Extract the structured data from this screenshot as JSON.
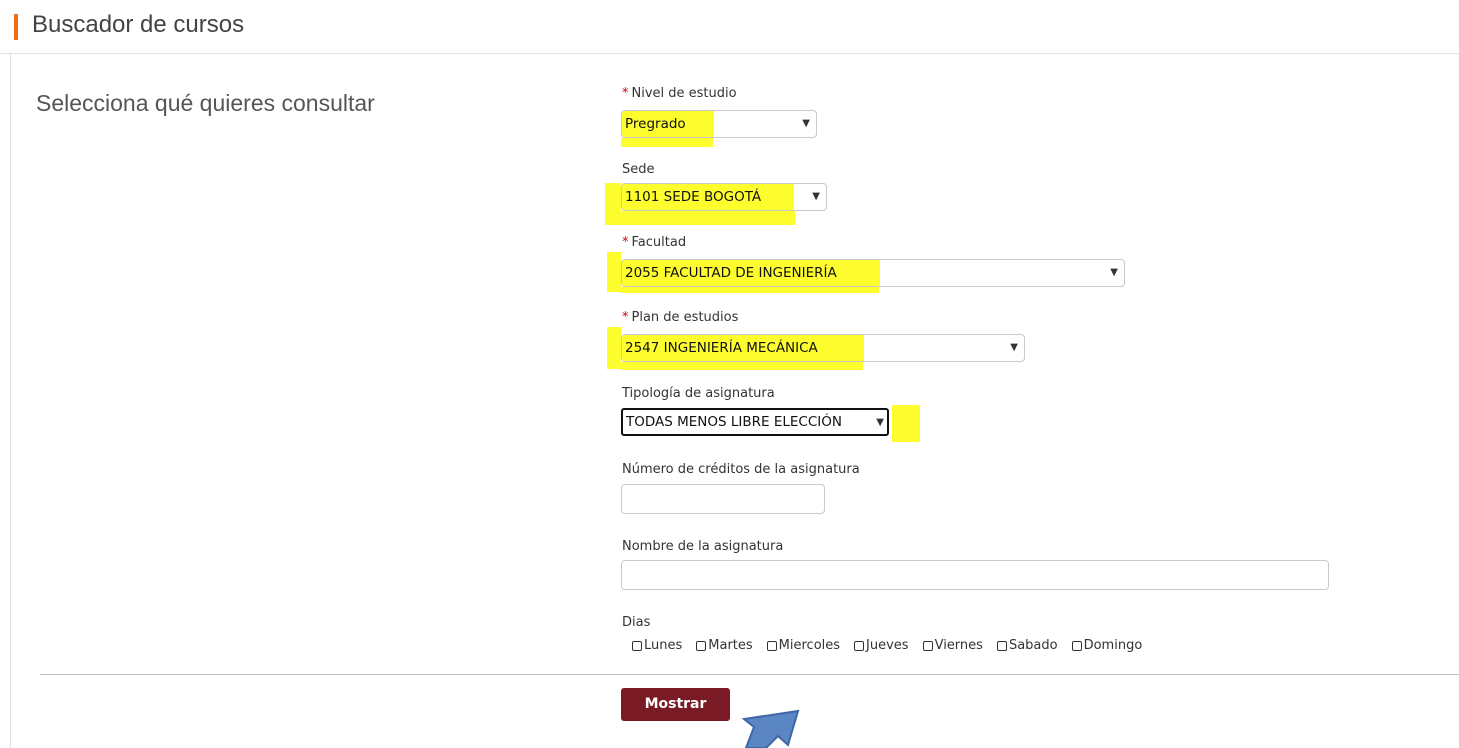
{
  "header": {
    "title": "Buscador de cursos",
    "accent_color": "#ef6a1b"
  },
  "section": {
    "title": "Selecciona qué quieres consultar"
  },
  "form": {
    "nivel": {
      "required_mark": "*",
      "label": "Nivel de estudio",
      "value": "Pregrado",
      "highlighted": true
    },
    "sede": {
      "label": "Sede",
      "value": "1101 SEDE BOGOTÁ",
      "highlighted": true
    },
    "facultad": {
      "required_mark": "*",
      "label": "Facultad",
      "value": "2055 FACULTAD DE INGENIERÍA",
      "highlighted": true
    },
    "plan": {
      "required_mark": "*",
      "label": "Plan de estudios",
      "value": "2547 INGENIERÍA MECÁNICA",
      "highlighted": true
    },
    "tipologia": {
      "label": "Tipología de asignatura",
      "value": "TODAS MENOS LIBRE ELECCIÓN",
      "focused": true
    },
    "creditos": {
      "label": "Número de créditos de la asignatura",
      "value": ""
    },
    "nombre": {
      "label": "Nombre de la asignatura",
      "value": ""
    },
    "dias": {
      "label": "Dias",
      "options": [
        "Lunes",
        "Martes",
        "Miercoles",
        "Jueves",
        "Viernes",
        "Sabado",
        "Domingo"
      ]
    }
  },
  "submit": {
    "label": "Mostrar",
    "color": "#7a1a25"
  },
  "annotation": {
    "highlight_color": "#fefe2f",
    "arrow_color": "#5b86c4",
    "arrow_icon": "up-left-arrow"
  }
}
